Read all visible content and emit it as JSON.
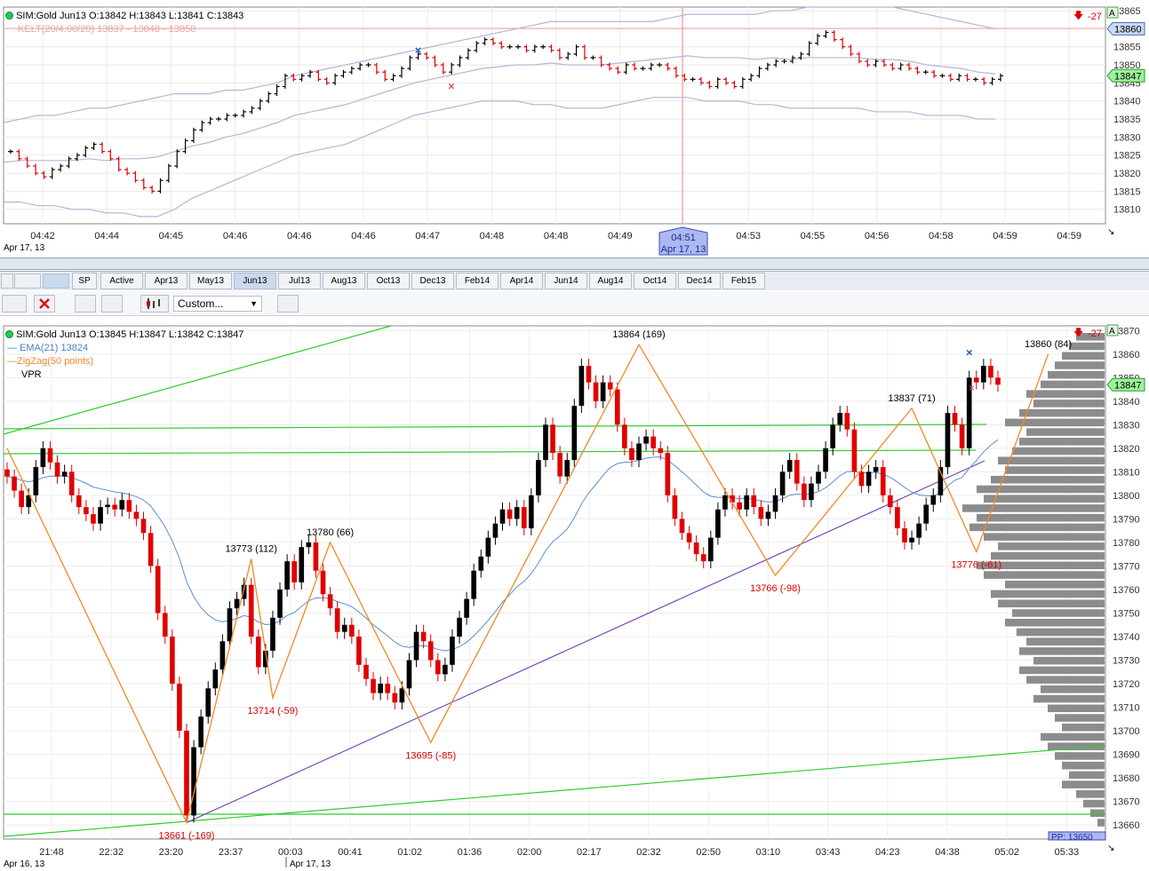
{
  "top": {
    "info": "SIM:Gold Jun13 O:13842 H:13843 L:13841 C:13843",
    "kelt": "KELT(20/4.00/20) 13837 - 13848 - 13858",
    "alert": "-27",
    "price_tag_top": "13860",
    "price_tag_last": "13847",
    "corner": "A",
    "date_label": "Apr 17, 13",
    "cursor_time": "04:51",
    "cursor_date": "Apr 17, 13"
  },
  "bottom": {
    "info": "SIM:Gold Jun13 O:13845 H:13847 L:13842 C:13847",
    "ema_label": "EMA(21)",
    "ema_value": "13824",
    "zigzag_label": "ZigZag(50 points)",
    "vpr_label": "VPR",
    "alert": "-27",
    "price_tag_last": "13847",
    "corner": "A",
    "date_left": "Apr 16, 13",
    "date_right": "Apr 17, 13",
    "pp_label": "PP: 13650"
  },
  "tabs": [
    "SP",
    "Active",
    "Apr13",
    "May13",
    "Jun13",
    "Jul13",
    "Aug13",
    "Oct13",
    "Dec13",
    "Feb14",
    "Apr14",
    "Jun14",
    "Aug14",
    "Oct14",
    "Dec14",
    "Feb15"
  ],
  "active_tab": "Jun13",
  "toolbar": {
    "select_label": "Custom..."
  },
  "colors": {
    "up": "#000000",
    "down": "#e00000",
    "ema": "#5b8fd1",
    "zigzag": "#f08a24",
    "trend": "#2ecc2e",
    "purple": "#7a47b5",
    "kelt": "#b9b2d8"
  },
  "chart_data": [
    {
      "type": "line",
      "name": "top-pane",
      "ylim": [
        13806,
        13866
      ],
      "yticks": [
        13810,
        13815,
        13820,
        13825,
        13830,
        13835,
        13840,
        13845,
        13850,
        13855,
        13860,
        13865
      ],
      "xticks": [
        "04:42",
        "04:44",
        "04:45",
        "04:46",
        "04:46",
        "04:46",
        "04:47",
        "04:48",
        "04:48",
        "04:49",
        "04:51",
        "04:53",
        "04:55",
        "04:56",
        "04:58",
        "04:59",
        "04:59"
      ],
      "close": [
        13826,
        13824,
        13822,
        13820,
        13819,
        13821,
        13822,
        13824,
        13825,
        13827,
        13828,
        13826,
        13824,
        13821,
        13820,
        13818,
        13816,
        13815,
        13818,
        13822,
        13826,
        13829,
        13832,
        13834,
        13835,
        13835,
        13836,
        13836,
        13837,
        13838,
        13840,
        13842,
        13844,
        13847,
        13846,
        13847,
        13848,
        13846,
        13845,
        13847,
        13848,
        13849,
        13850,
        13850,
        13848,
        13846,
        13847,
        13849,
        13852,
        13853,
        13852,
        13850,
        13848,
        13850,
        13852,
        13854,
        13856,
        13857,
        13856,
        13855,
        13855,
        13855,
        13854,
        13855,
        13855,
        13854,
        13852,
        13853,
        13855,
        13852,
        13852,
        13850,
        13849,
        13848,
        13850,
        13849,
        13849,
        13850,
        13850,
        13849,
        13847,
        13846,
        13846,
        13845,
        13844,
        13846,
        13845,
        13844,
        13846,
        13847,
        13849,
        13850,
        13851,
        13851,
        13852,
        13853,
        13856,
        13858,
        13859,
        13857,
        13855,
        13853,
        13851,
        13850,
        13851,
        13850,
        13849,
        13850,
        13849,
        13848,
        13848,
        13847,
        13847,
        13846,
        13847,
        13846,
        13846,
        13845,
        13846,
        13847
      ],
      "kelt_upper": [
        13834,
        13835,
        13836,
        13836,
        13837,
        13838,
        13838,
        13839,
        13840,
        13841,
        13842,
        13842,
        13842,
        13843,
        13843,
        13844,
        13845,
        13847,
        13848,
        13849,
        13850,
        13851,
        13852,
        13853,
        13854,
        13855,
        13856,
        13857,
        13858,
        13859,
        13860,
        13861,
        13862,
        13862,
        13862,
        13862,
        13862,
        13862,
        13862,
        13863,
        13864,
        13864,
        13864,
        13864,
        13864,
        13865,
        13865,
        13866,
        13866,
        13866,
        13866,
        13866,
        13866,
        13865,
        13864,
        13863,
        13862,
        13861,
        13860
      ],
      "kelt_lower": [
        13812,
        13812,
        13811,
        13811,
        13810,
        13810,
        13809,
        13809,
        13808,
        13808,
        13810,
        13813,
        13815,
        13817,
        13819,
        13821,
        13823,
        13825,
        13826,
        13827,
        13828,
        13830,
        13832,
        13834,
        13836,
        13837,
        13838,
        13839,
        13840,
        13840,
        13840,
        13839,
        13839,
        13838,
        13838,
        13838,
        13839,
        13840,
        13841,
        13841,
        13841,
        13840,
        13840,
        13840,
        13839,
        13839,
        13838,
        13838,
        13838,
        13838,
        13838,
        13837,
        13837,
        13837,
        13836,
        13836,
        13836,
        13835,
        13835
      ],
      "xmarks": [
        {
          "i": 49,
          "v": 13854,
          "color": "#1a5fb4"
        },
        {
          "i": 53,
          "v": 13844,
          "color": "#e05050"
        }
      ]
    },
    {
      "type": "bar",
      "name": "bottom-pane-candles",
      "ylim": [
        13654,
        13872
      ],
      "yticks": [
        13660,
        13670,
        13680,
        13690,
        13700,
        13710,
        13720,
        13730,
        13740,
        13750,
        13760,
        13770,
        13780,
        13790,
        13800,
        13810,
        13820,
        13830,
        13840,
        13850,
        13860,
        13870
      ],
      "xticks": [
        "21:48",
        "22:32",
        "23:20",
        "23:37",
        "00:03",
        "00:41",
        "01:02",
        "01:36",
        "02:00",
        "02:17",
        "02:32",
        "02:50",
        "03:10",
        "03:43",
        "04:23",
        "04:38",
        "05:02",
        "05:33"
      ],
      "close": [
        13808,
        13802,
        13795,
        13800,
        13812,
        13820,
        13814,
        13808,
        13810,
        13800,
        13795,
        13792,
        13788,
        13795,
        13796,
        13794,
        13798,
        13793,
        13790,
        13784,
        13770,
        13750,
        13740,
        13720,
        13700,
        13664,
        13693,
        13706,
        13718,
        13726,
        13738,
        13752,
        13756,
        13762,
        13740,
        13727,
        13734,
        13748,
        13760,
        13772,
        13763,
        13778,
        13780,
        13768,
        13758,
        13752,
        13742,
        13745,
        13740,
        13728,
        13722,
        13716,
        13720,
        13716,
        13712,
        13718,
        13730,
        13742,
        13738,
        13730,
        13724,
        13728,
        13740,
        13748,
        13756,
        13768,
        13774,
        13782,
        13788,
        13794,
        13790,
        13795,
        13786,
        13800,
        13815,
        13830,
        13818,
        13808,
        13815,
        13838,
        13855,
        13848,
        13840,
        13848,
        13845,
        13830,
        13820,
        13815,
        13822,
        13825,
        13820,
        13818,
        13800,
        13790,
        13784,
        13780,
        13775,
        13772,
        13782,
        13794,
        13800,
        13797,
        13794,
        13800,
        13795,
        13790,
        13793,
        13800,
        13810,
        13815,
        13805,
        13798,
        13805,
        13810,
        13820,
        13830,
        13835,
        13828,
        13810,
        13804,
        13810,
        13812,
        13800,
        13795,
        13786,
        13780,
        13782,
        13788,
        13796,
        13800,
        13812,
        13835,
        13830,
        13820,
        13850,
        13848,
        13855,
        13850,
        13847
      ],
      "zigzag": [
        [
          0,
          13820
        ],
        [
          25,
          13661
        ],
        [
          34,
          13773
        ],
        [
          37,
          13714
        ],
        [
          45,
          13780
        ],
        [
          59,
          13695
        ],
        [
          88,
          13864
        ],
        [
          107,
          13766
        ],
        [
          126,
          13837
        ],
        [
          135,
          13776
        ],
        [
          145,
          13860
        ]
      ],
      "zigzag_labels": [
        "13661 (-169)",
        "13773 (112)",
        "13714 (-59)",
        "13780 (66)",
        "13695 (-85)",
        "13864 (169)",
        "13766 (-98)",
        "13837 (71)",
        "13776 (-61)",
        "13860 (84)"
      ],
      "vpr_profile": [
        0.05,
        0.1,
        0.15,
        0.2,
        0.3,
        0.25,
        0.3,
        0.35,
        0.4,
        0.45,
        0.3,
        0.35,
        0.4,
        0.5,
        0.45,
        0.55,
        0.6,
        0.5,
        0.6,
        0.55,
        0.62,
        0.7,
        0.65,
        0.75,
        0.8,
        0.7,
        0.85,
        0.9,
        0.8,
        0.75,
        0.85,
        0.95,
        0.9,
        1.0,
        0.85,
        0.9,
        0.8,
        0.7,
        0.75,
        0.65,
        0.6,
        0.55,
        0.7,
        0.6,
        0.5,
        0.55,
        0.45,
        0.4,
        0.35,
        0.3,
        0.25,
        0.2
      ]
    }
  ]
}
